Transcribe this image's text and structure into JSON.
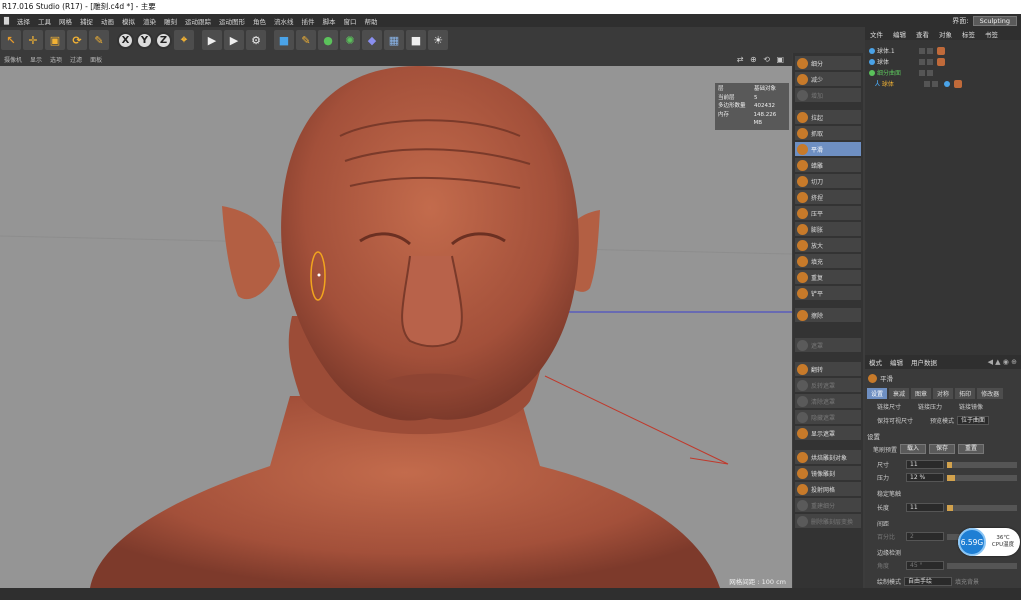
{
  "window": {
    "title": "R17.016 Studio (R17) - [雕刻.c4d *] - 主要"
  },
  "menu": {
    "items": [
      "█",
      "选择",
      "工具",
      "网格",
      "捕捉",
      "动画",
      "模拟",
      "渲染",
      "雕刻",
      "运动跟踪",
      "运动图形",
      "角色",
      "流水线",
      "插件",
      "脚本",
      "窗口",
      "帮助"
    ],
    "layout_label": "界面:",
    "layout_value": "Sculpting"
  },
  "toolbar": {
    "icons": [
      "pointer-icon",
      "move-icon",
      "scale-icon",
      "rotate-icon",
      "recent-tools-icon",
      "x-axis-icon",
      "y-axis-icon",
      "z-axis-icon",
      "coord-system-icon",
      "render-view-icon",
      "render-picture-icon",
      "render-settings-icon",
      "cube-icon",
      "pen-icon",
      "subdivision-icon",
      "array-icon",
      "deformer-icon",
      "floor-icon",
      "camera-icon",
      "light-icon"
    ],
    "axis_labels": [
      "X",
      "Y",
      "Z"
    ]
  },
  "viewport": {
    "menu": [
      "摄像机",
      "显示",
      "选项",
      "过滤",
      "面板"
    ],
    "nav_icons": "⇄ ⊕ ⟲ ▣",
    "stats": [
      {
        "label": "层",
        "value": "基础对象"
      },
      {
        "label": "当前层",
        "value": "5"
      },
      {
        "label": "多边形数量",
        "value": "402432"
      },
      {
        "label": "内存",
        "value": "148.226 MB"
      }
    ],
    "grid_spacing": "网格间距 : 100 cm"
  },
  "sculpt_tools": {
    "items": [
      {
        "label": "细分",
        "state": "normal",
        "icon": "subdivide-icon"
      },
      {
        "label": "减少",
        "state": "normal",
        "icon": "decrease-icon"
      },
      {
        "label": "增加",
        "state": "dim",
        "icon": "increase-icon"
      },
      {
        "label": "拉起",
        "state": "normal",
        "icon": "pull-brush-icon"
      },
      {
        "label": "抓取",
        "state": "normal",
        "icon": "grab-brush-icon"
      },
      {
        "label": "平滑",
        "state": "active",
        "icon": "smooth-brush-icon"
      },
      {
        "label": "蜡雕",
        "state": "normal",
        "icon": "wax-brush-icon"
      },
      {
        "label": "切刀",
        "state": "normal",
        "icon": "knife-brush-icon"
      },
      {
        "label": "挤捏",
        "state": "normal",
        "icon": "pinch-brush-icon"
      },
      {
        "label": "压平",
        "state": "normal",
        "icon": "flatten-brush-icon"
      },
      {
        "label": "膨胀",
        "state": "normal",
        "icon": "inflate-brush-icon"
      },
      {
        "label": "放大",
        "state": "normal",
        "icon": "amplify-brush-icon"
      },
      {
        "label": "填充",
        "state": "normal",
        "icon": "fill-brush-icon"
      },
      {
        "label": "重复",
        "state": "normal",
        "icon": "repeat-brush-icon"
      },
      {
        "label": "铲平",
        "state": "normal",
        "icon": "scrape-brush-icon"
      },
      {
        "label": "擦除",
        "state": "normal",
        "icon": "erase-brush-icon"
      },
      {
        "label": "遮罩",
        "state": "dim",
        "icon": "mask-brush-icon"
      },
      {
        "label": "翻转",
        "state": "normal",
        "icon": "invert-mask-icon"
      },
      {
        "label": "反转遮罩",
        "state": "dim",
        "icon": "clear-mask-icon"
      },
      {
        "label": "清除遮罩",
        "state": "dim",
        "icon": "blur-mask-icon"
      },
      {
        "label": "隐藏遮罩",
        "state": "dim",
        "icon": "hide-mask-icon"
      },
      {
        "label": "显示遮罩",
        "state": "normal",
        "icon": "show-mask-icon"
      },
      {
        "label": "烘焙雕刻对象",
        "state": "normal",
        "icon": "bake-icon"
      },
      {
        "label": "镜像雕刻",
        "state": "normal",
        "icon": "mirror-icon"
      },
      {
        "label": "投射网格",
        "state": "normal",
        "icon": "project-mesh-icon"
      },
      {
        "label": "重建细分",
        "state": "dim",
        "icon": "rebuild-icon"
      },
      {
        "label": "删除雕刻层变换",
        "state": "dim",
        "icon": "delete-layer-icon"
      }
    ]
  },
  "object_manager": {
    "menu": [
      "文件",
      "编辑",
      "查看",
      "对象",
      "标签",
      "书签"
    ],
    "objects": [
      {
        "name": "球体.1",
        "color": "#4aa3e8",
        "selected": false
      },
      {
        "name": "球体",
        "color": "#4aa3e8",
        "selected": false
      },
      {
        "name": "细分曲面",
        "color": "#5bc25b",
        "selected": false
      },
      {
        "name": "球体",
        "color": "#4aa3e8",
        "selected": true
      }
    ]
  },
  "attributes": {
    "menu": [
      "模式",
      "编辑",
      "用户数据"
    ],
    "nav": "◀ ▲ ◉ ⊕",
    "tool_name": "平滑",
    "tabs": [
      "设置",
      "衰减",
      "图章",
      "对称",
      "拓印",
      "修改器"
    ],
    "link_size": "链接尺寸",
    "link_pressure": "链接压力",
    "link_mirror": "链接镜像",
    "keep_visible_size": "保持可视尺寸",
    "preview_mode_label": "预览模式",
    "preview_mode_value": "位于曲面",
    "section_settings": "设置",
    "brush_preset_label": "笔刷预置",
    "load_btn": "载入",
    "save_btn": "保存",
    "reset_btn": "重置",
    "size_label": "尺寸",
    "size_value": "11",
    "size_fill": 0.07,
    "pressure_label": "压力",
    "pressure_value": "12 %",
    "pressure_fill": 0.12,
    "stable_stroke": "稳定笔触",
    "length_label": "长度",
    "length_value": "11",
    "length_fill": 0.08,
    "spacing_label": "间距",
    "spacing_percent_label": "百分比",
    "spacing_percent_value": "2",
    "edge_detect": "边缘检测",
    "angle_label": "角度",
    "angle_value": "45 °",
    "draw_mode_label": "绘制模式",
    "draw_mode_value": "自由手绘",
    "fill_back": "填充背景"
  },
  "cpu": {
    "clock": "6.59G",
    "temp": "36℃",
    "label": "CPU温度"
  },
  "colors": {
    "skin": "#b25c42",
    "active_blue": "#6e8fc2",
    "cursor_ring": "#f2a51e"
  }
}
